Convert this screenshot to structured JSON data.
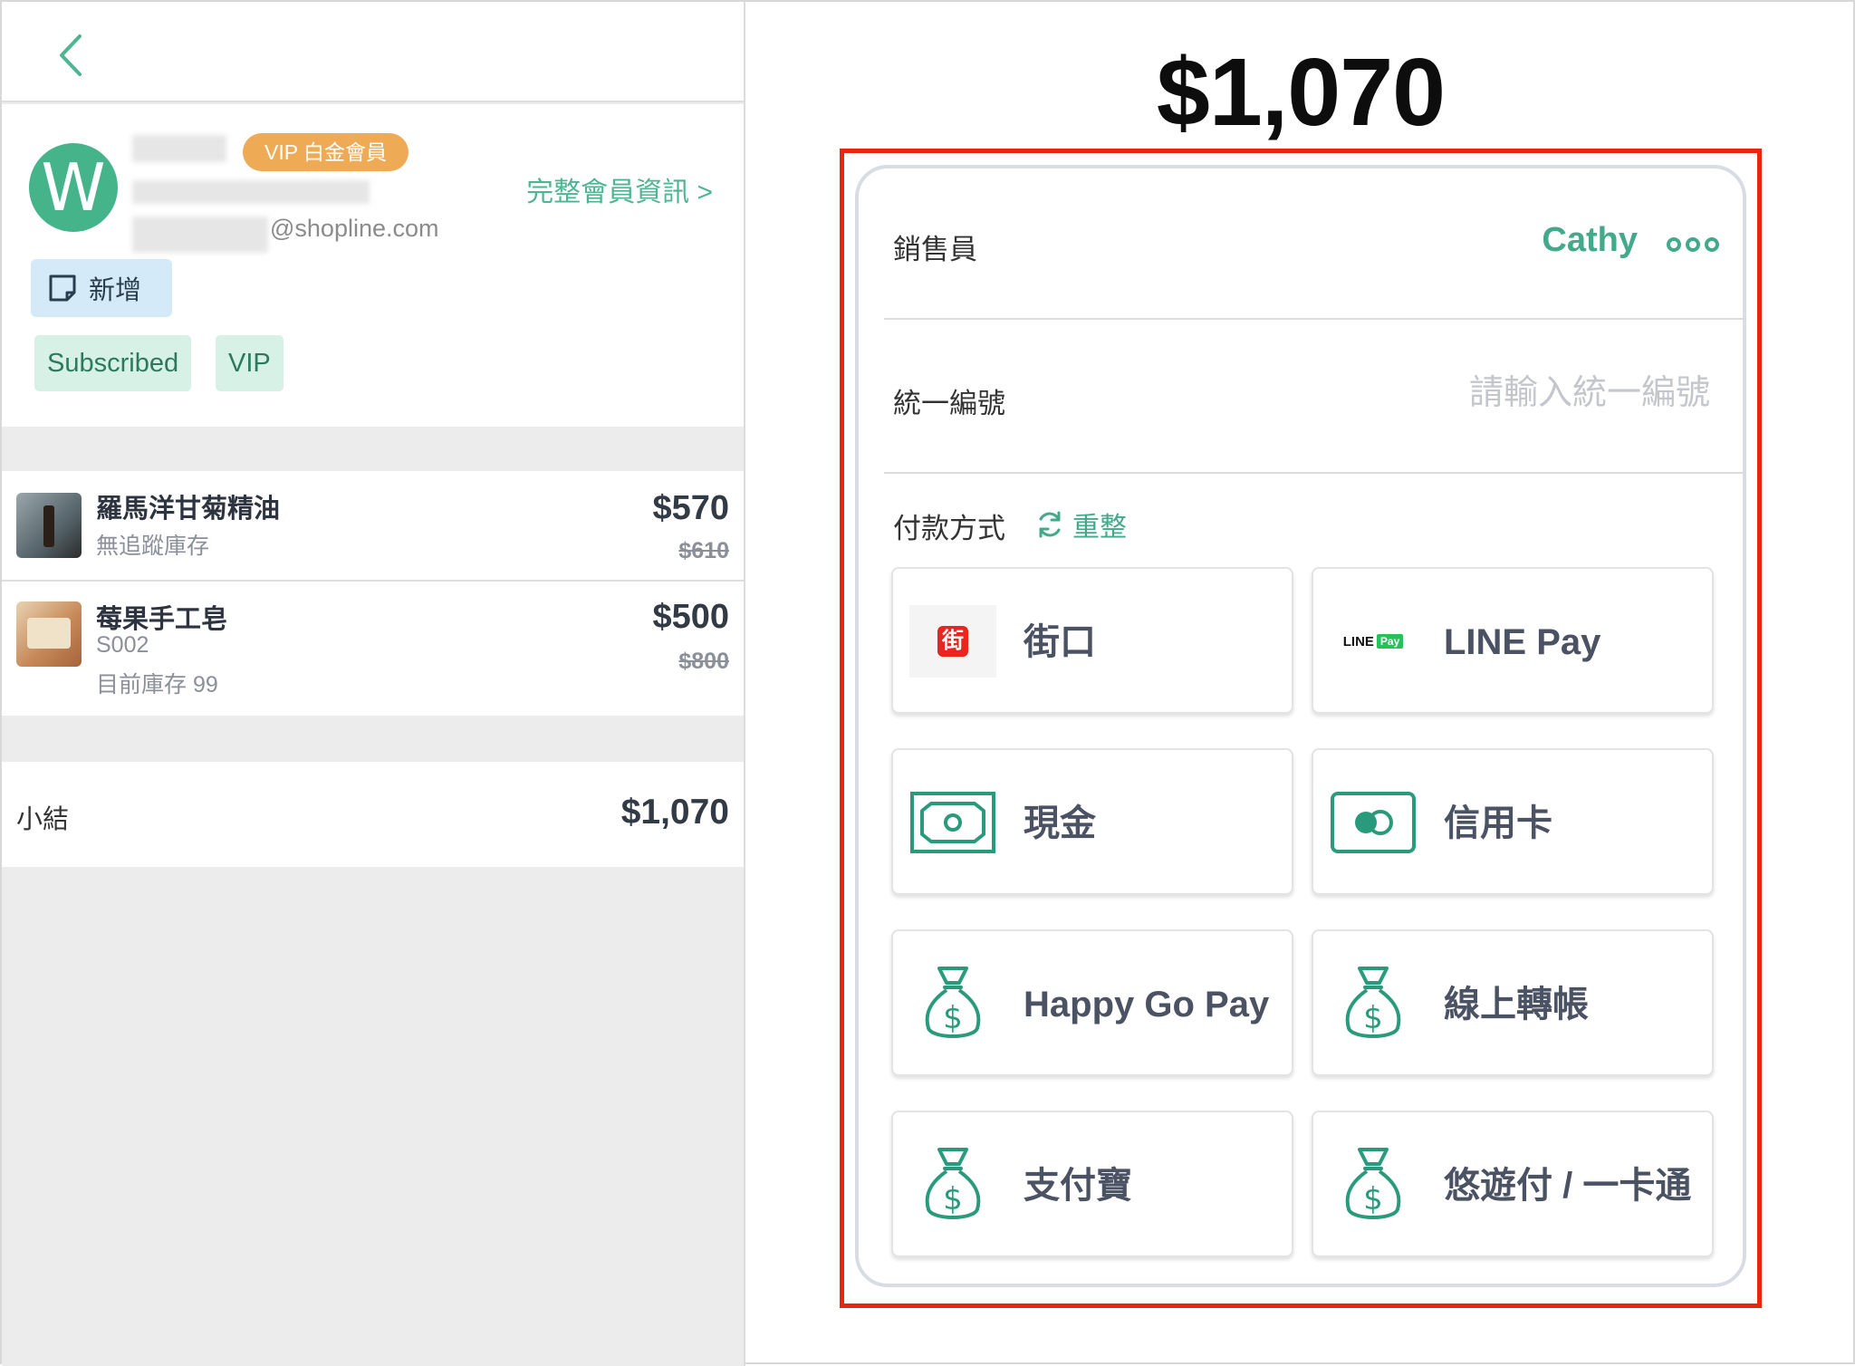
{
  "left": {
    "member": {
      "avatar_letter": "W",
      "vip_tag": "VIP 白金會員",
      "email": "@shopline.com",
      "full_info_link": "完整會員資訊 >",
      "add_button": "新增",
      "tags": [
        "Subscribed",
        "VIP"
      ]
    },
    "items": [
      {
        "name": "羅馬洋甘菊精油",
        "sub1": "無追蹤庫存",
        "sub2": "",
        "price": "$570",
        "original_price": "$610"
      },
      {
        "name": "莓果手工皂",
        "sub1": "S002",
        "sub2": "目前庫存 99",
        "price": "$500",
        "original_price": "$800"
      }
    ],
    "subtotal": {
      "label": "小結",
      "value": "$1,070"
    }
  },
  "right": {
    "total": "$1,070",
    "seller": {
      "label": "銷售員",
      "value": "Cathy"
    },
    "tax_id": {
      "label": "統一編號",
      "placeholder": "請輸入統一編號"
    },
    "payment": {
      "label": "付款方式",
      "reset": "重整",
      "methods": [
        {
          "label": "街口",
          "icon": "jkopay-icon"
        },
        {
          "label": "LINE Pay",
          "icon": "line-pay-icon"
        },
        {
          "label": "現金",
          "icon": "cash-icon"
        },
        {
          "label": "信用卡",
          "icon": "credit-card-icon"
        },
        {
          "label": "Happy Go Pay",
          "icon": "money-bag-icon"
        },
        {
          "label": "線上轉帳",
          "icon": "money-bag-icon"
        },
        {
          "label": "支付寶",
          "icon": "money-bag-icon"
        },
        {
          "label": "悠遊付 / 一卡通",
          "icon": "money-bag-icon"
        }
      ]
    },
    "line_pay_logo": {
      "line": "LINE",
      "pay": "Pay"
    },
    "jkopay_logo": "街"
  },
  "colors": {
    "accent": "#42a98a",
    "highlight": "#e8250f",
    "vip": "#eeaa55"
  }
}
